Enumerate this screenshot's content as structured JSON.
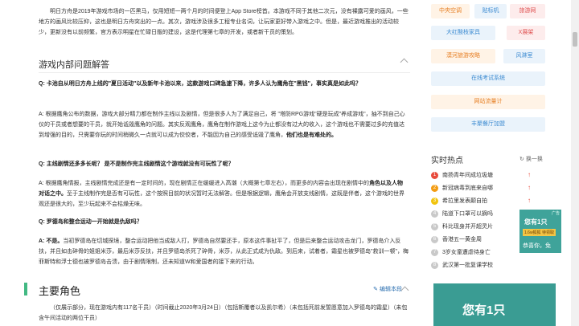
{
  "content": {
    "intro_paragraph": "明日方舟是2019年游戏市场的一匹黑马，仅用短短一两个月的时间便登上App Store榜首。本游戏不同于其他二次元，没有裸露可爱的画风，一些地方的画风比较压抑，这也是明日方舟突出的一点。其次，游戏涉及很多工程专业名词，让玩家更好带入游戏之中。但是，最近游戏推出的活动较少，更新没有以前频繁，官方表示明星在忙碌日版的建设，这是代理第七章的开发，或者新干员的策划。",
    "faq_section": {
      "title": "游戏内部问题解答",
      "q1": "Q: 卡池自从明日方舟上线的\"夏日活动\"以及新年卡池以来，这款游戏口碑急速下降，许多人认为鹰角在\"黑钱\"，事实真是如此吗？",
      "a1_part1": "A: 根据鹰角公布的数据，游戏大部分精力都在制作主线以及剧情，但是很多人为了满足自己，将 \"塔防RPG游戏\"硬是玩成\"养成游戏\"，抽不到自己心仪的干员或者想要的干员，就开始诋毁鹰角的问题。其实反观鹰角，鹰角在制作游戏上这今为止都没有过大的收入，这个游戏也不需要过多的充值达到增强的目的，只需要你玩的时间稍微久一点就可以成为佼佼者，不能因为自己的感受诋毁了鹰角，",
      "a1_bold": "他们也是有难处的。",
      "q2": "Q: 主线剧情还多多长呢？ 是不是制作完主线剧情这个游戏就没有可玩性了呢？",
      "a2_part1": "A: 根据鹰角情报，主线剧情完成还是有一定时间的，现在剧情正在缓缓进入高潮（大概第七章左右），而更多的内容会出现在剧情中的",
      "a2_bold": "角色以及人物对话之中。",
      "a2_part2": "至于主线制作完是否有可玩性，这个按照目前的状况暂时无法解答。但是根据逻辑，鹰角会开放支线剧情，这既是伴者，这个游戏的世界观还是很大的，至少玩起来不会枯燥无味。",
      "q3": "Q: 罗德岛和整合运动一开始就是仇敌吗？",
      "a3_bold": "A: 不是。",
      "a3_part1": "当初罗德岛在切城探境，整合运动把他当成敌人打，罗德岛自然要还手，原本这件事扯平了，但是后来整合运动攻击龙门，罗德岛介入反扶，并且如击碎骨的姐姐米莎，最后米莎反扶，并且罗德岛杀死了碎骨，米莎，从此正式成为仇敌。到后来，试着者，霜星也被罗德岛\"救训一顿\"，梅菲斯特和浮士德也被罗德岛击溃，由于剧情限制，还未知道W和爱国者的接下来的行动。"
    },
    "main_section": {
      "title": "主要角色",
      "edit_label": "编辑本段",
      "text": "（仅展示部分，现在游戏内有117名干员）（时间截止2020年3月24日）（包括斯覆者以及凯尔希）（未包括死前发誓愿意加入罗德岛的霜星）（未包含午间活动的两位干员）"
    }
  },
  "sidebar": {
    "tags": [
      "中央空调",
      "贴标机",
      "旅游网",
      "大红酸枝家具",
      "X展架",
      "漠河旅游攻略",
      "风淋室",
      "在线考试系统",
      "网站流量计",
      "丰聚餐厅加盟"
    ],
    "hot": {
      "title": "实时热点",
      "refresh_label": "换一换",
      "items": [
        {
          "rank": "1",
          "text": "南扬青年间成垃圾塘"
        },
        {
          "rank": "2",
          "text": "新冠病毒到底来自哪"
        },
        {
          "rank": "3",
          "text": "希拉里发表颠自拍"
        },
        {
          "rank": "4",
          "text": "陆道下口罩可以摘吗"
        },
        {
          "rank": "5",
          "text": "科比现身并开超灵片"
        },
        {
          "rank": "6",
          "text": "香港五一黄金周"
        },
        {
          "rank": "7",
          "text": "3岁女童遭虐待身亡"
        },
        {
          "rank": "8",
          "text": "武汉第一批复课学校"
        }
      ]
    },
    "ad_small": {
      "line1": "您有1只",
      "line2": "1.6w狐狐 待领取",
      "line3": "恭喜你，免"
    },
    "ad_big": {
      "text": "您有1只"
    },
    "ad_label": "广告"
  }
}
